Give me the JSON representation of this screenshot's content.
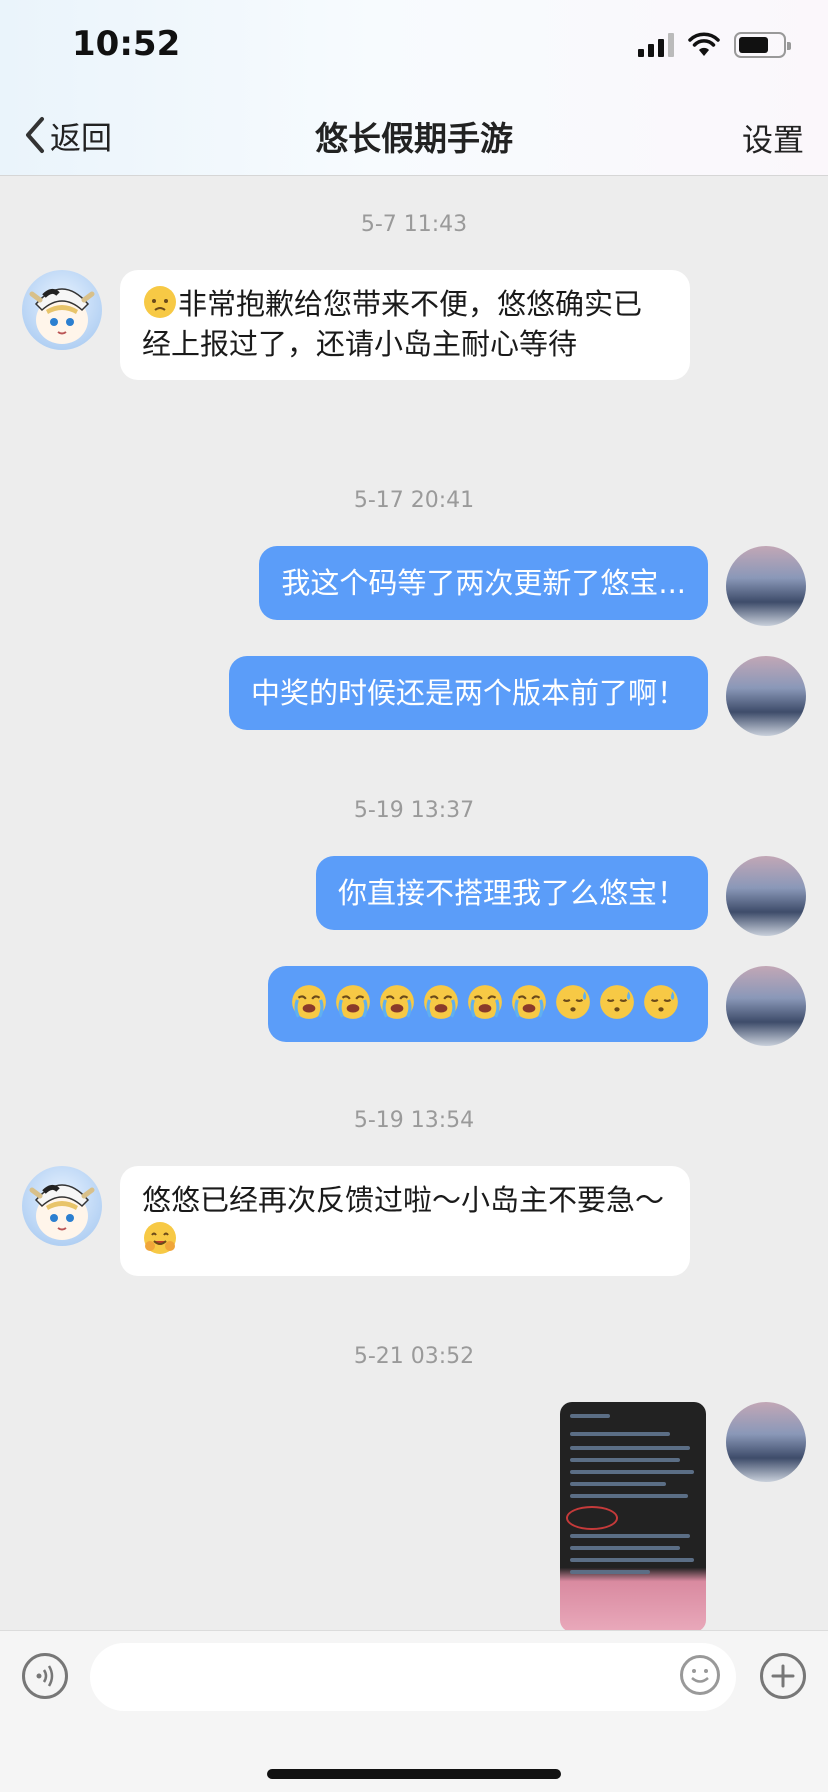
{
  "status_bar": {
    "time": "10:52"
  },
  "nav": {
    "back_label": "返回",
    "title": "悠长假期手游",
    "settings_label": "设置"
  },
  "messages": [
    {
      "timestamp": "5-7 11:43",
      "side": "incoming",
      "text": "非常抱歉给您带来不便，悠悠确实已经上报过了，还请小岛主耐心等待",
      "leading_emoji": "sad-face-icon"
    },
    {
      "timestamp": "5-17 20:41",
      "side": "outgoing",
      "text": "我这个码等了两次更新了悠宝..."
    },
    {
      "side": "outgoing",
      "text": "中奖的时候还是两个版本前了啊！"
    },
    {
      "timestamp": "5-19 13:37",
      "side": "outgoing",
      "text": "你直接不搭理我了么悠宝！"
    },
    {
      "side": "outgoing",
      "emoji_row": [
        "loudly-crying-face-icon",
        "loudly-crying-face-icon",
        "loudly-crying-face-icon",
        "loudly-crying-face-icon",
        "loudly-crying-face-icon",
        "loudly-crying-face-icon",
        "downcast-sweat-face-icon",
        "downcast-sweat-face-icon",
        "downcast-sweat-face-icon"
      ]
    },
    {
      "timestamp": "5-19 13:54",
      "side": "incoming",
      "text": "悠悠已经再次反馈过啦～小岛主不要急～",
      "trailing_emoji": "hugging-face-icon"
    },
    {
      "timestamp": "5-21 03:52",
      "side": "outgoing",
      "attachment": "screenshot-thumbnail"
    }
  ],
  "input_bar": {
    "placeholder": ""
  },
  "colors": {
    "outgoing_bubble": "#5b9df9",
    "incoming_bubble": "#ffffff",
    "background": "#ededed"
  }
}
